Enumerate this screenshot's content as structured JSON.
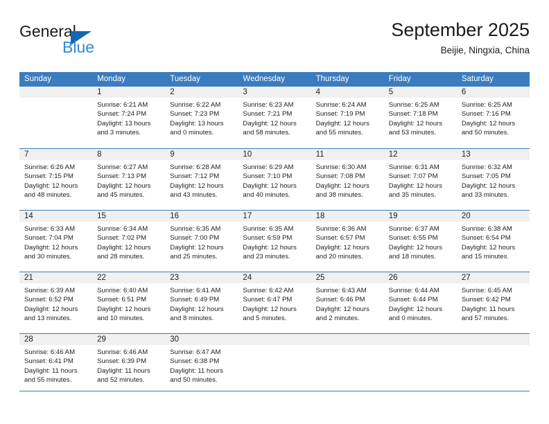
{
  "brand": {
    "name_top": "General",
    "name_bottom": "Blue",
    "accent_color": "#1268b3",
    "accent_color_light": "#2e8bd4"
  },
  "header": {
    "title": "September 2025",
    "subtitle": "Beijie, Ningxia, China"
  },
  "theme": {
    "header_row_bg": "#3a7cbe",
    "daynum_band_bg": "#f0f0f0",
    "row_divider": "#3a7cbe",
    "text": "#222222"
  },
  "calendar": {
    "weekdays": [
      "Sunday",
      "Monday",
      "Tuesday",
      "Wednesday",
      "Thursday",
      "Friday",
      "Saturday"
    ],
    "weeks": [
      [
        {
          "day": "",
          "sunrise": "",
          "sunset": "",
          "daylight1": "",
          "daylight2": ""
        },
        {
          "day": "1",
          "sunrise": "Sunrise: 6:21 AM",
          "sunset": "Sunset: 7:24 PM",
          "daylight1": "Daylight: 13 hours",
          "daylight2": "and 3 minutes."
        },
        {
          "day": "2",
          "sunrise": "Sunrise: 6:22 AM",
          "sunset": "Sunset: 7:23 PM",
          "daylight1": "Daylight: 13 hours",
          "daylight2": "and 0 minutes."
        },
        {
          "day": "3",
          "sunrise": "Sunrise: 6:23 AM",
          "sunset": "Sunset: 7:21 PM",
          "daylight1": "Daylight: 12 hours",
          "daylight2": "and 58 minutes."
        },
        {
          "day": "4",
          "sunrise": "Sunrise: 6:24 AM",
          "sunset": "Sunset: 7:19 PM",
          "daylight1": "Daylight: 12 hours",
          "daylight2": "and 55 minutes."
        },
        {
          "day": "5",
          "sunrise": "Sunrise: 6:25 AM",
          "sunset": "Sunset: 7:18 PM",
          "daylight1": "Daylight: 12 hours",
          "daylight2": "and 53 minutes."
        },
        {
          "day": "6",
          "sunrise": "Sunrise: 6:25 AM",
          "sunset": "Sunset: 7:16 PM",
          "daylight1": "Daylight: 12 hours",
          "daylight2": "and 50 minutes."
        }
      ],
      [
        {
          "day": "7",
          "sunrise": "Sunrise: 6:26 AM",
          "sunset": "Sunset: 7:15 PM",
          "daylight1": "Daylight: 12 hours",
          "daylight2": "and 48 minutes."
        },
        {
          "day": "8",
          "sunrise": "Sunrise: 6:27 AM",
          "sunset": "Sunset: 7:13 PM",
          "daylight1": "Daylight: 12 hours",
          "daylight2": "and 45 minutes."
        },
        {
          "day": "9",
          "sunrise": "Sunrise: 6:28 AM",
          "sunset": "Sunset: 7:12 PM",
          "daylight1": "Daylight: 12 hours",
          "daylight2": "and 43 minutes."
        },
        {
          "day": "10",
          "sunrise": "Sunrise: 6:29 AM",
          "sunset": "Sunset: 7:10 PM",
          "daylight1": "Daylight: 12 hours",
          "daylight2": "and 40 minutes."
        },
        {
          "day": "11",
          "sunrise": "Sunrise: 6:30 AM",
          "sunset": "Sunset: 7:08 PM",
          "daylight1": "Daylight: 12 hours",
          "daylight2": "and 38 minutes."
        },
        {
          "day": "12",
          "sunrise": "Sunrise: 6:31 AM",
          "sunset": "Sunset: 7:07 PM",
          "daylight1": "Daylight: 12 hours",
          "daylight2": "and 35 minutes."
        },
        {
          "day": "13",
          "sunrise": "Sunrise: 6:32 AM",
          "sunset": "Sunset: 7:05 PM",
          "daylight1": "Daylight: 12 hours",
          "daylight2": "and 33 minutes."
        }
      ],
      [
        {
          "day": "14",
          "sunrise": "Sunrise: 6:33 AM",
          "sunset": "Sunset: 7:04 PM",
          "daylight1": "Daylight: 12 hours",
          "daylight2": "and 30 minutes."
        },
        {
          "day": "15",
          "sunrise": "Sunrise: 6:34 AM",
          "sunset": "Sunset: 7:02 PM",
          "daylight1": "Daylight: 12 hours",
          "daylight2": "and 28 minutes."
        },
        {
          "day": "16",
          "sunrise": "Sunrise: 6:35 AM",
          "sunset": "Sunset: 7:00 PM",
          "daylight1": "Daylight: 12 hours",
          "daylight2": "and 25 minutes."
        },
        {
          "day": "17",
          "sunrise": "Sunrise: 6:35 AM",
          "sunset": "Sunset: 6:59 PM",
          "daylight1": "Daylight: 12 hours",
          "daylight2": "and 23 minutes."
        },
        {
          "day": "18",
          "sunrise": "Sunrise: 6:36 AM",
          "sunset": "Sunset: 6:57 PM",
          "daylight1": "Daylight: 12 hours",
          "daylight2": "and 20 minutes."
        },
        {
          "day": "19",
          "sunrise": "Sunrise: 6:37 AM",
          "sunset": "Sunset: 6:55 PM",
          "daylight1": "Daylight: 12 hours",
          "daylight2": "and 18 minutes."
        },
        {
          "day": "20",
          "sunrise": "Sunrise: 6:38 AM",
          "sunset": "Sunset: 6:54 PM",
          "daylight1": "Daylight: 12 hours",
          "daylight2": "and 15 minutes."
        }
      ],
      [
        {
          "day": "21",
          "sunrise": "Sunrise: 6:39 AM",
          "sunset": "Sunset: 6:52 PM",
          "daylight1": "Daylight: 12 hours",
          "daylight2": "and 13 minutes."
        },
        {
          "day": "22",
          "sunrise": "Sunrise: 6:40 AM",
          "sunset": "Sunset: 6:51 PM",
          "daylight1": "Daylight: 12 hours",
          "daylight2": "and 10 minutes."
        },
        {
          "day": "23",
          "sunrise": "Sunrise: 6:41 AM",
          "sunset": "Sunset: 6:49 PM",
          "daylight1": "Daylight: 12 hours",
          "daylight2": "and 8 minutes."
        },
        {
          "day": "24",
          "sunrise": "Sunrise: 6:42 AM",
          "sunset": "Sunset: 6:47 PM",
          "daylight1": "Daylight: 12 hours",
          "daylight2": "and 5 minutes."
        },
        {
          "day": "25",
          "sunrise": "Sunrise: 6:43 AM",
          "sunset": "Sunset: 6:46 PM",
          "daylight1": "Daylight: 12 hours",
          "daylight2": "and 2 minutes."
        },
        {
          "day": "26",
          "sunrise": "Sunrise: 6:44 AM",
          "sunset": "Sunset: 6:44 PM",
          "daylight1": "Daylight: 12 hours",
          "daylight2": "and 0 minutes."
        },
        {
          "day": "27",
          "sunrise": "Sunrise: 6:45 AM",
          "sunset": "Sunset: 6:42 PM",
          "daylight1": "Daylight: 11 hours",
          "daylight2": "and 57 minutes."
        }
      ],
      [
        {
          "day": "28",
          "sunrise": "Sunrise: 6:46 AM",
          "sunset": "Sunset: 6:41 PM",
          "daylight1": "Daylight: 11 hours",
          "daylight2": "and 55 minutes."
        },
        {
          "day": "29",
          "sunrise": "Sunrise: 6:46 AM",
          "sunset": "Sunset: 6:39 PM",
          "daylight1": "Daylight: 11 hours",
          "daylight2": "and 52 minutes."
        },
        {
          "day": "30",
          "sunrise": "Sunrise: 6:47 AM",
          "sunset": "Sunset: 6:38 PM",
          "daylight1": "Daylight: 11 hours",
          "daylight2": "and 50 minutes."
        },
        {
          "day": "",
          "sunrise": "",
          "sunset": "",
          "daylight1": "",
          "daylight2": ""
        },
        {
          "day": "",
          "sunrise": "",
          "sunset": "",
          "daylight1": "",
          "daylight2": ""
        },
        {
          "day": "",
          "sunrise": "",
          "sunset": "",
          "daylight1": "",
          "daylight2": ""
        },
        {
          "day": "",
          "sunrise": "",
          "sunset": "",
          "daylight1": "",
          "daylight2": ""
        }
      ]
    ]
  }
}
